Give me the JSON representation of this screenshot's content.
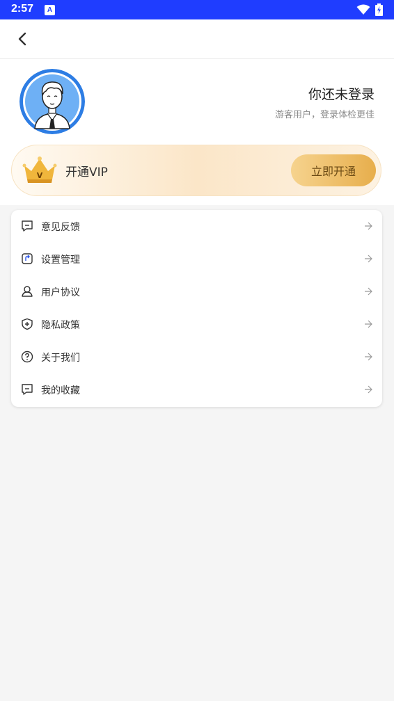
{
  "status_bar": {
    "time": "2:57",
    "notification_icon": "A"
  },
  "header": {
    "back_icon": "chevron-left-icon"
  },
  "profile": {
    "title": "你还未登录",
    "subtitle": "游客用户，登录体检更佳"
  },
  "vip": {
    "label": "开通VIP",
    "button": "立即开通",
    "crown_letter": "V"
  },
  "menu": {
    "items": [
      {
        "label": "意见反馈",
        "icon": "feedback-icon"
      },
      {
        "label": "设置管理",
        "icon": "settings-icon"
      },
      {
        "label": "用户协议",
        "icon": "user-icon"
      },
      {
        "label": "隐私政策",
        "icon": "shield-icon"
      },
      {
        "label": "关于我们",
        "icon": "help-icon"
      },
      {
        "label": "我的收藏",
        "icon": "favorites-icon"
      }
    ]
  },
  "colors": {
    "status_bar": "#1f3dff",
    "vip_button": "#e7ae4c",
    "page_bg": "#f5f5f5"
  }
}
